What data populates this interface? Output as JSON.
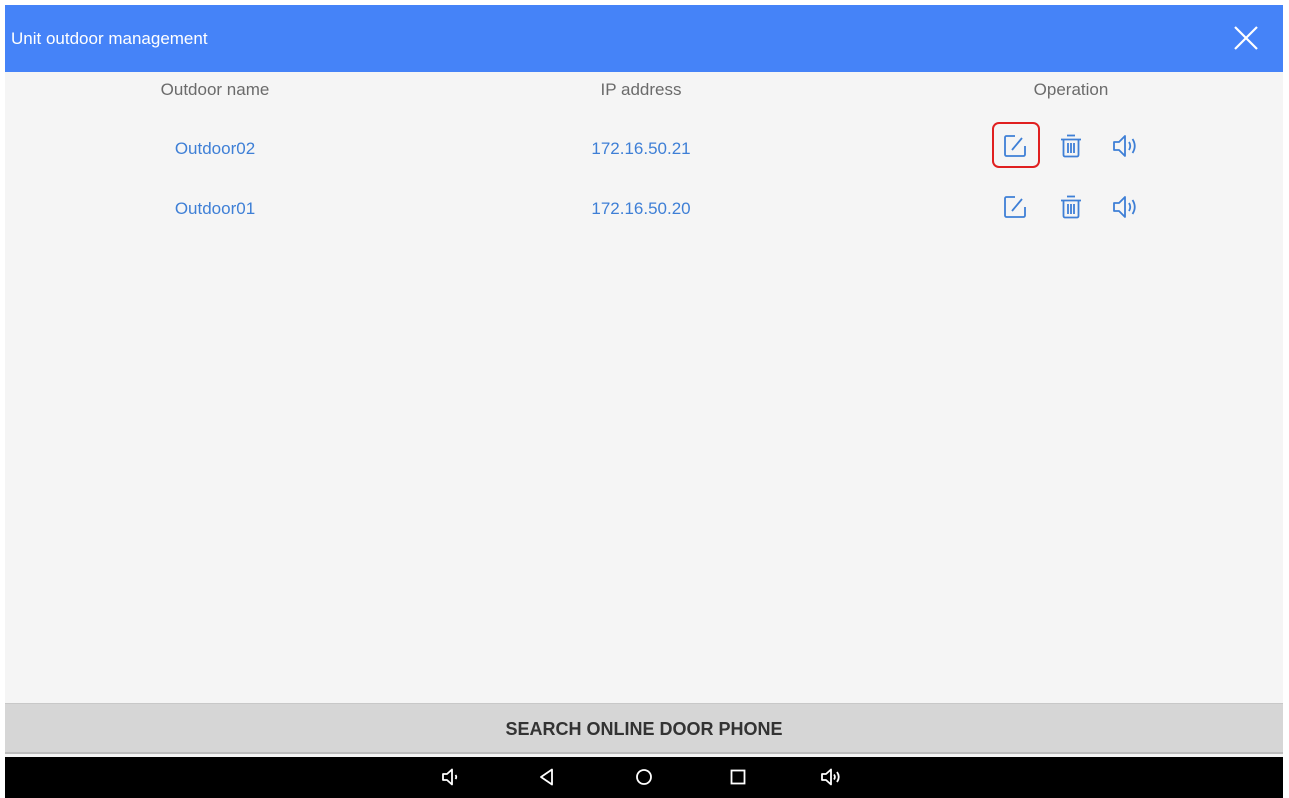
{
  "header": {
    "title": "Unit outdoor management",
    "close_icon": "close-icon"
  },
  "table": {
    "columns": [
      "Outdoor name",
      "IP address",
      "Operation"
    ],
    "rows": [
      {
        "name": "Outdoor02",
        "ip": "172.16.50.21",
        "operations": [
          "edit-icon",
          "delete-icon",
          "volume-icon"
        ],
        "edit_highlighted": true
      },
      {
        "name": "Outdoor01",
        "ip": "172.16.50.20",
        "operations": [
          "edit-icon",
          "delete-icon",
          "volume-icon"
        ],
        "edit_highlighted": false
      }
    ]
  },
  "search_button": {
    "label": "SEARCH ONLINE DOOR PHONE"
  },
  "navbar": {
    "icons": [
      "volume-down-icon",
      "back-icon",
      "home-icon",
      "recents-icon",
      "volume-up-icon"
    ]
  },
  "colors": {
    "header_bg": "#4583f8",
    "link_blue": "#3e7fd6",
    "highlight_red": "#e02020",
    "button_gray": "#d6d6d6"
  }
}
